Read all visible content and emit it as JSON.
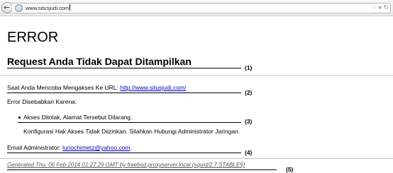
{
  "browser": {
    "url": "www.situsjudi.com"
  },
  "page": {
    "title": "ERROR",
    "subtitle": "Request Anda Tidak Dapat Ditampilkan",
    "url_prefix": "Saat Anda Mencoba Mengakses Ke URL:",
    "url_link": "http://www.situsjudi.com/",
    "error_cause_label": "Error Disebabkan Karena:",
    "bullet_text": "Akses Ditolak, Alamat Tersebut Dilarang.",
    "config_text": "Konfigurasi Hak Akses Tidak Diizinkan. Silahkan Hubungi Administrator Jaringan.",
    "admin_prefix": "Email Administrator:",
    "admin_email": "luriochimetz@yahoo.com",
    "admin_suffix": ".",
    "footer": "Generated Thu, 06 Feb 2014 01:27:29 GMT by freebsd.proxyserver.local (squid/2.7.STABLE9)"
  },
  "annotations": [
    "(1)",
    "(2)",
    "(3)",
    "(4)",
    "(5)"
  ]
}
